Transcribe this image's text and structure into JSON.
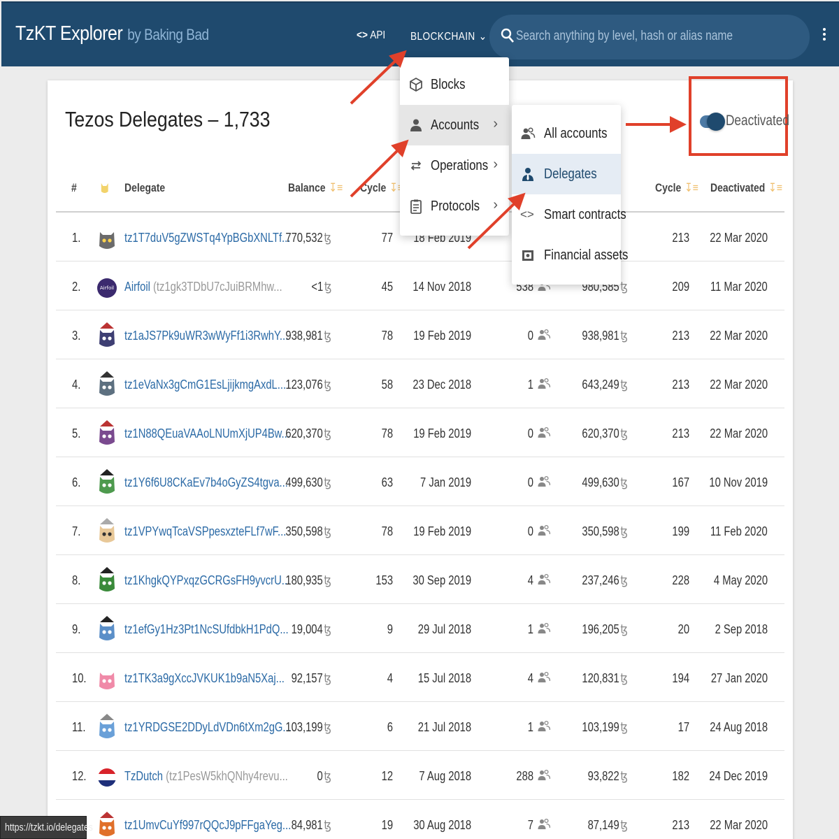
{
  "header": {
    "brand": "TzKT Explorer",
    "brand_by": "by Baking Bad",
    "api_label": "API",
    "blockchain_label": "BLOCKCHAIN",
    "search_placeholder": "Search anything by level, hash or alias name"
  },
  "page": {
    "title": "Tezos Delegates – 1,733",
    "toggle_label": "Deactivated",
    "toggle_on": true
  },
  "columns": {
    "num": "#",
    "delegate": "Delegate",
    "balance": "Balance",
    "cycle1": "Cycle",
    "cycle2": "Cycle",
    "deactivated": "Deactivated"
  },
  "blockchain_menu": [
    {
      "label": "Blocks",
      "icon": "cube-icon",
      "has_submenu": false
    },
    {
      "label": "Accounts",
      "icon": "person-icon",
      "has_submenu": true
    },
    {
      "label": "Operations",
      "icon": "swap-icon",
      "has_submenu": true
    },
    {
      "label": "Protocols",
      "icon": "clipboard-icon",
      "has_submenu": true
    }
  ],
  "accounts_menu": [
    {
      "label": "All accounts",
      "icon": "people-icon"
    },
    {
      "label": "Delegates",
      "icon": "delegate-icon"
    },
    {
      "label": "Smart contracts",
      "icon": "code-icon"
    },
    {
      "label": "Financial assets",
      "icon": "asset-icon"
    }
  ],
  "rows": [
    {
      "n": "1.",
      "delegate": "tz1T7duV5gZWSTq4YpBGbXNLTf...",
      "alias": "",
      "balance": "770,532",
      "cycle": "77",
      "date": "18 Feb 2019",
      "delegators": "",
      "staking": "",
      "cycle2": "213",
      "deactivated": "22 Mar 2020"
    },
    {
      "n": "2.",
      "delegate": "Airfoil",
      "alias": "(tz1gk3TDbU7cJuiBRMhw...",
      "balance": "<1",
      "cycle": "45",
      "date": "14 Nov 2018",
      "delegators": "538",
      "staking": "980,585",
      "cycle2": "209",
      "deactivated": "11 Mar 2020"
    },
    {
      "n": "3.",
      "delegate": "tz1aJS7Pk9uWR3wWyFf1i3RwhY...",
      "alias": "",
      "balance": "938,981",
      "cycle": "78",
      "date": "19 Feb 2019",
      "delegators": "0",
      "staking": "938,981",
      "cycle2": "213",
      "deactivated": "22 Mar 2020"
    },
    {
      "n": "4.",
      "delegate": "tz1eVaNx3gCmG1EsLjijkmgAxdL...",
      "alias": "",
      "balance": "123,076",
      "cycle": "58",
      "date": "23 Dec 2018",
      "delegators": "1",
      "staking": "643,249",
      "cycle2": "213",
      "deactivated": "22 Mar 2020"
    },
    {
      "n": "5.",
      "delegate": "tz1N88QEuaVAAoLNUmXjUP4Bw...",
      "alias": "",
      "balance": "620,370",
      "cycle": "78",
      "date": "19 Feb 2019",
      "delegators": "0",
      "staking": "620,370",
      "cycle2": "213",
      "deactivated": "22 Mar 2020"
    },
    {
      "n": "6.",
      "delegate": "tz1Y6f6U8CKaEv7b4oGyZS4tgva...",
      "alias": "",
      "balance": "499,630",
      "cycle": "63",
      "date": "7 Jan 2019",
      "delegators": "0",
      "staking": "499,630",
      "cycle2": "167",
      "deactivated": "10 Nov 2019"
    },
    {
      "n": "7.",
      "delegate": "tz1VPYwqTcaVSPpesxzteFLf7wF...",
      "alias": "",
      "balance": "350,598",
      "cycle": "78",
      "date": "19 Feb 2019",
      "delegators": "0",
      "staking": "350,598",
      "cycle2": "199",
      "deactivated": "11 Feb 2020"
    },
    {
      "n": "8.",
      "delegate": "tz1KhgkQYPxqzGCRGsFH9yvcrU...",
      "alias": "",
      "balance": "180,935",
      "cycle": "153",
      "date": "30 Sep 2019",
      "delegators": "4",
      "staking": "237,246",
      "cycle2": "228",
      "deactivated": "4 May 2020"
    },
    {
      "n": "9.",
      "delegate": "tz1efGy1Hz3Pt1NcSUfdbkH1PdQ...",
      "alias": "",
      "balance": "19,004",
      "cycle": "9",
      "date": "29 Jul 2018",
      "delegators": "1",
      "staking": "196,205",
      "cycle2": "20",
      "deactivated": "2 Sep 2018"
    },
    {
      "n": "10.",
      "delegate": "tz1TK3a9gXccJVKUK1b9aN5Xaj...",
      "alias": "",
      "balance": "92,157",
      "cycle": "4",
      "date": "15 Jul 2018",
      "delegators": "4",
      "staking": "120,831",
      "cycle2": "194",
      "deactivated": "27 Jan 2020"
    },
    {
      "n": "11.",
      "delegate": "tz1YRDGSE2DDyLdVDn6tXm2gG...",
      "alias": "",
      "balance": "103,199",
      "cycle": "6",
      "date": "21 Jul 2018",
      "delegators": "1",
      "staking": "103,199",
      "cycle2": "17",
      "deactivated": "24 Aug 2018"
    },
    {
      "n": "12.",
      "delegate": "TzDutch",
      "alias": "(tz1PesW5khQNhy4revu...",
      "balance": "0",
      "cycle": "12",
      "date": "7 Aug 2018",
      "delegators": "288",
      "staking": "93,822",
      "cycle2": "182",
      "deactivated": "24 Dec 2019"
    },
    {
      "n": "",
      "delegate": "tz1UmvCuYf997rQQcJ9pFFgaYeg...",
      "alias": "",
      "balance": "84,981",
      "cycle": "19",
      "date": "30 Aug 2018",
      "delegators": "7",
      "staking": "87,149",
      "cycle2": "213",
      "deactivated": "22 Mar 2020"
    }
  ],
  "avatars": [
    {
      "body": "#6b6b6b",
      "eyes": "#ffd34d",
      "hat": ""
    },
    {
      "body": "#3b2a6e",
      "eyes": "",
      "hat": "",
      "logo": "Airfoil"
    },
    {
      "body": "#3e3f73",
      "eyes": "#ffffff",
      "hat": "#b33"
    },
    {
      "body": "#5d7080",
      "eyes": "#ffffff",
      "hat": "#333"
    },
    {
      "body": "#7a4a8f",
      "eyes": "#ffffff",
      "hat": "#b33"
    },
    {
      "body": "#4e9a4e",
      "eyes": "#ffffff",
      "hat": "#222"
    },
    {
      "body": "#e8c898",
      "eyes": "#333",
      "hat": "#aaa"
    },
    {
      "body": "#3a8a3a",
      "eyes": "#ffffff",
      "hat": "#222"
    },
    {
      "body": "#5b8fc8",
      "eyes": "#ffffff",
      "hat": "#222"
    },
    {
      "body": "#f08aa8",
      "eyes": "#ffffff",
      "hat": ""
    },
    {
      "body": "#6aa0d8",
      "eyes": "#ffffff",
      "hat": "#888"
    },
    {
      "body": "#ffffff",
      "eyes": "",
      "hat": "",
      "flag": true
    },
    {
      "body": "#e0702a",
      "eyes": "#ffffff",
      "hat": "#b33"
    }
  ],
  "tez_symbol": "ꜩ",
  "status_url": "https://tzkt.io/delegates",
  "colors": {
    "header": "#1f4a6e",
    "link": "#2b6aa6",
    "highlight": "#e0402a"
  }
}
